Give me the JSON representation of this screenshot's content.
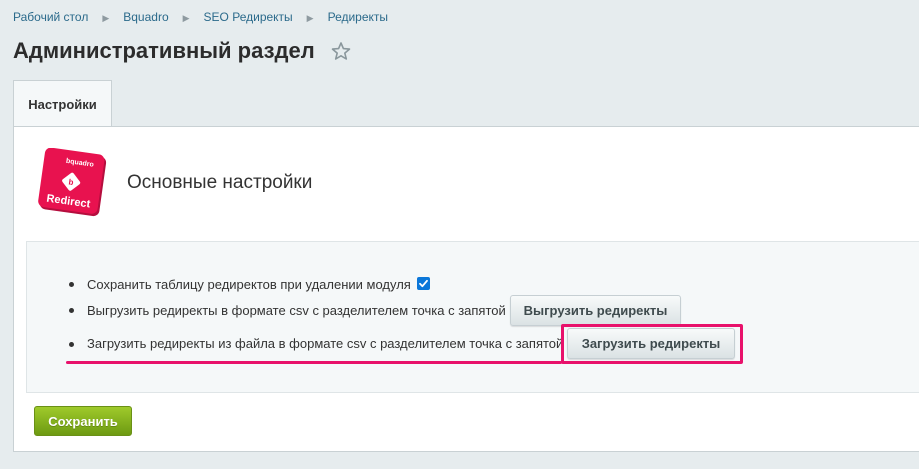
{
  "breadcrumbs": [
    "Рабочий стол",
    "Bquadro",
    "SEO Редиректы",
    "Редиректы"
  ],
  "page": {
    "title": "Административный раздел"
  },
  "tabs": [
    {
      "label": "Настройки"
    }
  ],
  "section": {
    "title": "Основные настройки"
  },
  "logo": {
    "brand": "bquadro",
    "text": "Redirect",
    "color": "#e8124f"
  },
  "options": [
    {
      "label": "Сохранить таблицу редиректов при удалении модуля",
      "checked": true
    },
    {
      "label": "Выгрузить редиректы в формате csv с разделителем точка с запятой",
      "button": "Выгрузить редиректы"
    },
    {
      "label": "Загрузить редиректы из файла в формате csv с разделителем точка с запятой",
      "button": "Загрузить редиректы"
    }
  ],
  "actions": {
    "save_label": "Сохранить"
  },
  "colors": {
    "highlight": "#e8116b",
    "save": "#7fae17",
    "link": "#2b6a8b",
    "checkbox": "#0b77d9"
  }
}
